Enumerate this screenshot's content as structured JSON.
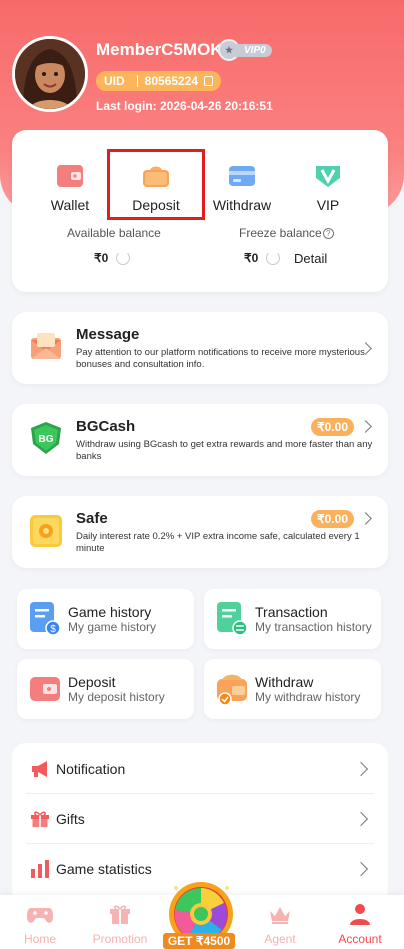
{
  "profile": {
    "username": "MemberC5MOK",
    "vip_label": "VIP0",
    "uid_label": "UID",
    "uid_value": "80565224",
    "last_login": "Last login: 2026-04-26 20:16:51"
  },
  "wallet": {
    "actions": [
      {
        "label": "Wallet",
        "icon": "wallet-icon"
      },
      {
        "label": "Deposit",
        "icon": "deposit-icon"
      },
      {
        "label": "Withdraw",
        "icon": "withdraw-icon"
      },
      {
        "label": "VIP",
        "icon": "vip-icon"
      }
    ],
    "available_label": "Available balance",
    "available_value": "₹0",
    "freeze_label": "Freeze balance",
    "freeze_value": "₹0",
    "detail_label": "Detail"
  },
  "message": {
    "title": "Message",
    "desc": "Pay attention to our platform notifications to receive more mysterious bonuses and consultation info."
  },
  "bgcash": {
    "title": "BGCash",
    "amount": "₹0.00",
    "desc": "Withdraw using BGcash to get extra rewards and more faster than any banks",
    "logo_text": "BG"
  },
  "safe": {
    "title": "Safe",
    "amount": "₹0.00",
    "desc": "Daily interest rate 0.2% + VIP extra income safe, calculated every 1 minute"
  },
  "history": [
    {
      "title": "Game history",
      "sub": "My game history"
    },
    {
      "title": "Transaction",
      "sub": "My transaction history"
    },
    {
      "title": "Deposit",
      "sub": "My deposit history"
    },
    {
      "title": "Withdraw",
      "sub": "My withdraw history"
    }
  ],
  "menu": [
    {
      "label": "Notification"
    },
    {
      "label": "Gifts"
    },
    {
      "label": "Game statistics"
    }
  ],
  "tabbar": {
    "home": "Home",
    "promotion": "Promotion",
    "wheel_get": "GET ₹4500",
    "agent": "Agent",
    "account": "Account"
  },
  "colors": {
    "brand": "#f86a6a",
    "accent_orange": "#fbb15c",
    "active_tab": "#f14a4a"
  }
}
